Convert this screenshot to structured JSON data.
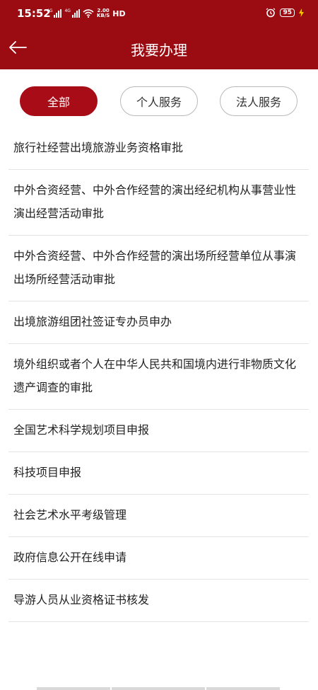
{
  "status_bar": {
    "time": "15:52",
    "network_1": "4G",
    "network_2": "4G",
    "speed_value": "2.00",
    "speed_unit": "KB/S",
    "hd": "HD",
    "battery": "95"
  },
  "header": {
    "title": "我要办理"
  },
  "tabs": [
    {
      "label": "全部",
      "active": true
    },
    {
      "label": "个人服务",
      "active": false
    },
    {
      "label": "法人服务",
      "active": false
    }
  ],
  "items": [
    "旅行社经营出境旅游业务资格审批",
    "中外合资经营、中外合作经营的演出经纪机构从事营业性演出经营活动审批",
    "中外合资经营、中外合作经营的演出场所经营单位从事演出场所经营活动审批",
    "出境旅游组团社签证专办员申办",
    "境外组织或者个人在中华人民共和国境内进行非物质文化遗产调查的审批",
    "全国艺术科学规划项目申报",
    "科技项目申报",
    "社会艺术水平考级管理",
    "政府信息公开在线申请",
    "导游人员从业资格证书核发"
  ],
  "colors": {
    "brand": "#9b0b12",
    "tab_active": "#a80d17"
  }
}
